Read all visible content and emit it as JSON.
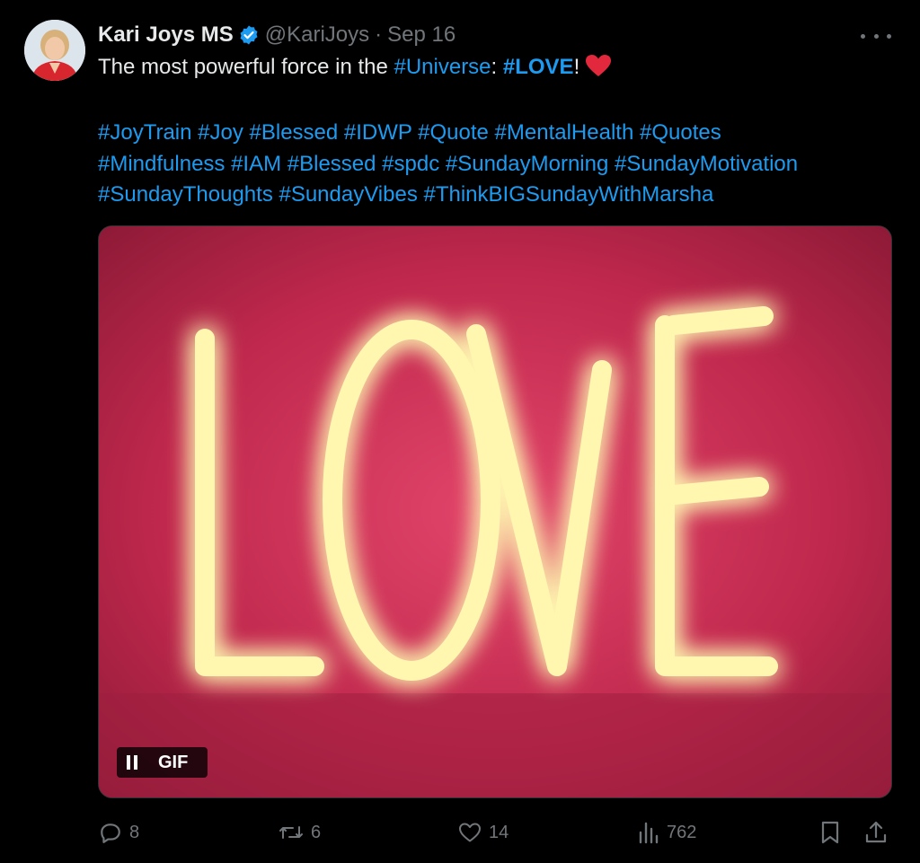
{
  "author": {
    "name": "Kari Joys MS",
    "handle": "@KariJoys",
    "separator": "·",
    "date": "Sep 16"
  },
  "text": {
    "line1_prefix": "The most powerful force in the ",
    "line1_tag1": "#Universe",
    "line1_colon": ": ",
    "line1_tag2": "#LOVE",
    "line1_excl": "!",
    "hashtags_line1": "#JoyTrain #Joy #Blessed #IDWP #Quote #MentalHealth #Quotes",
    "hashtags_line2": "#Mindfulness #IAM #Blessed #spdc #SundayMorning #SundayMotivation",
    "hashtags_line3": "#SundayThoughts #SundayVibes #ThinkBIGSundayWithMarsha"
  },
  "media": {
    "sign_text": "LOVE",
    "gif_badge": "GIF",
    "colors": {
      "wall": "#c0284d",
      "neon": "#fff7b0"
    }
  },
  "actions": {
    "replies": "8",
    "reposts": "6",
    "likes": "14",
    "views": "762"
  },
  "icons": {
    "verified": "verified-badge-icon",
    "more": "more-icon",
    "heart_emoji": "red-heart-emoji",
    "reply": "reply-icon",
    "repost": "repost-icon",
    "like": "like-icon",
    "views": "views-icon",
    "bookmark": "bookmark-icon",
    "share": "share-icon"
  },
  "colors": {
    "accent": "#1d9bf0",
    "muted": "#71767b",
    "text": "#e7e9ea",
    "background": "#000000"
  }
}
